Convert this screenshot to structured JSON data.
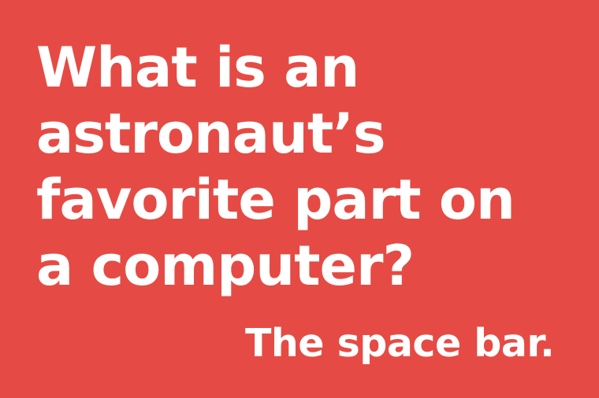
{
  "colors": {
    "background": "#E54B44",
    "text": "#FFFFFF"
  },
  "question": {
    "lines": [
      "What is an",
      "astronaut’s",
      "favorite part on",
      "a computer?"
    ]
  },
  "answer": "The space bar."
}
